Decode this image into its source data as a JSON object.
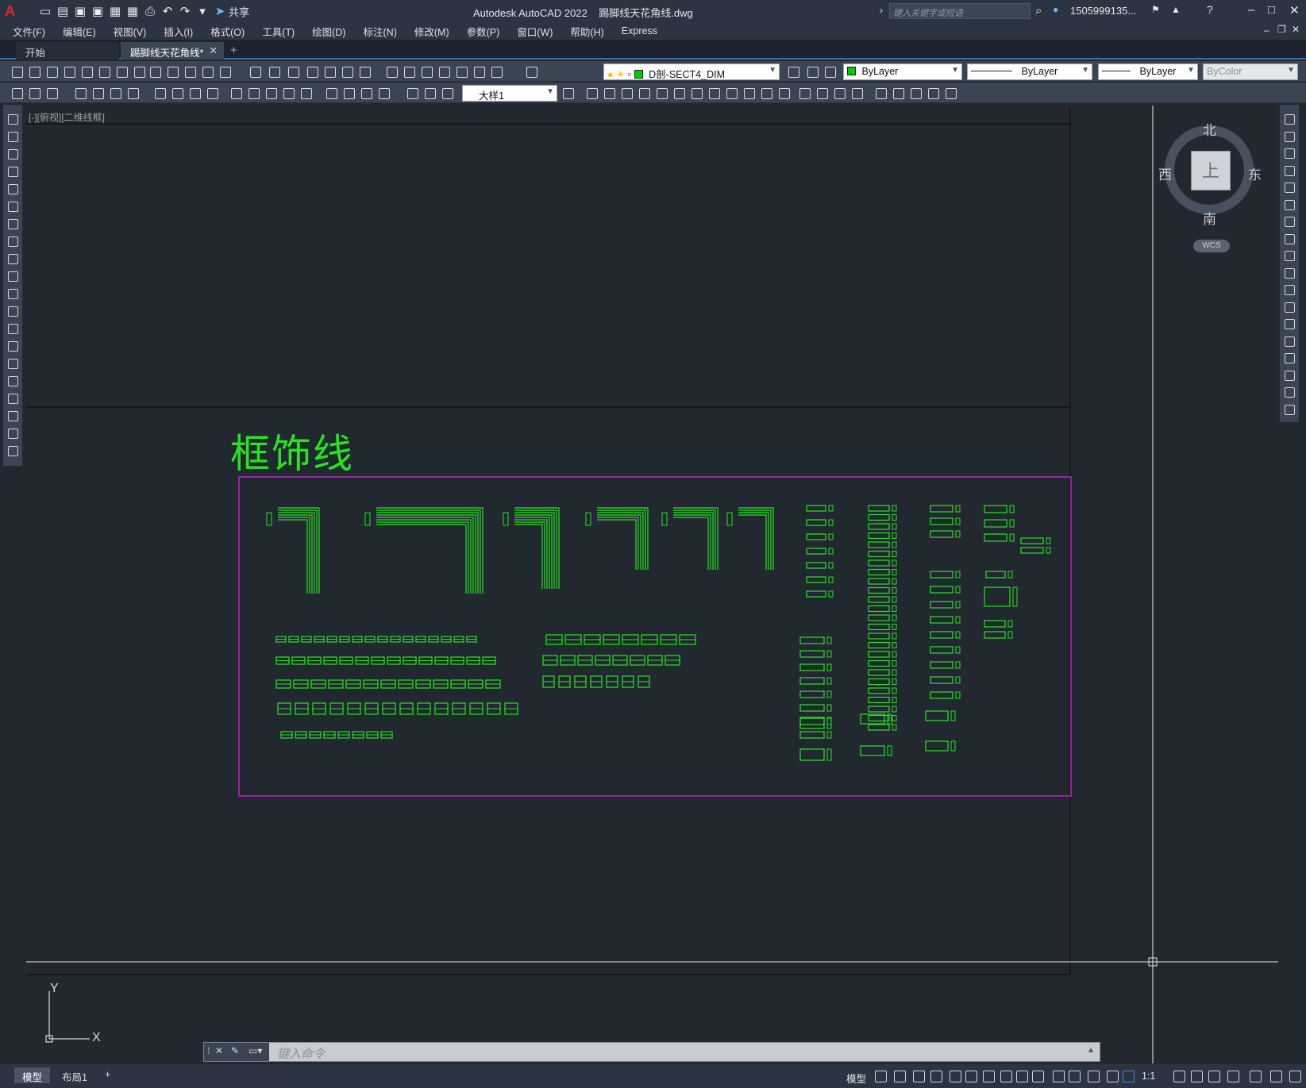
{
  "titlebar": {
    "app_logo": "A",
    "title": "Autodesk AutoCAD 2022    踢脚线天花角线.dwg",
    "share_label": "共享",
    "search_placeholder": "键入关键字或短语",
    "user": "1505999135...",
    "help": "?"
  },
  "menu": [
    "文件(F)",
    "编辑(E)",
    "视图(V)",
    "插入(I)",
    "格式(O)",
    "工具(T)",
    "绘图(D)",
    "标注(N)",
    "修改(M)",
    "参数(P)",
    "窗口(W)",
    "帮助(H)",
    "Express"
  ],
  "tabs": {
    "start": "开始",
    "file": "踢脚线天花角线*"
  },
  "toolbar": {
    "layer": "D剖-SECT4_DIM",
    "color": "ByLayer",
    "linetype": "ByLayer",
    "lineweight": "ByLayer",
    "plotstyle": "ByColor",
    "dimstyle": "大样1"
  },
  "viewport_label": "[-][俯视][二维线框]",
  "drawing": {
    "title": "框饰线",
    "title_color": "#27e51f",
    "frame_color": "#c81cc8",
    "geometry_color": "#27e51f"
  },
  "viewcube": {
    "north": "北",
    "south": "南",
    "east": "东",
    "west": "西",
    "face": "上",
    "wcs": "WCS"
  },
  "ucs": {
    "x": "X",
    "y": "Y"
  },
  "command": {
    "placeholder": "键入命令"
  },
  "status": {
    "layouts": [
      "模型",
      "布局1"
    ],
    "model": "模型",
    "scale": "1:1"
  }
}
